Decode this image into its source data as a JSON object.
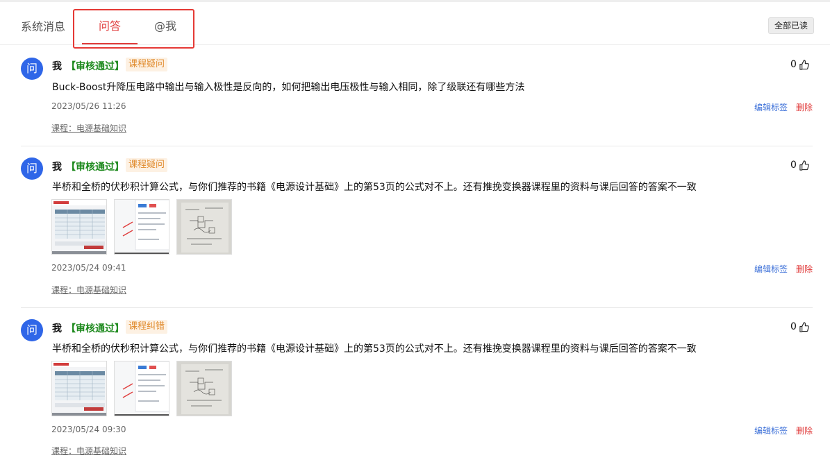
{
  "tabs": {
    "system": "系统消息",
    "qa": "问答",
    "at_me": "@我",
    "mark_all_read": "全部已读"
  },
  "colors": {
    "accent": "#e03b3b",
    "avatar": "#2f66e8",
    "approved": "#1e8a1e",
    "tag": "#e08a2c",
    "link": "#3b6fd8"
  },
  "items": [
    {
      "avatar_char": "问",
      "author": "我",
      "status": "【审核通过】",
      "tag": "课程疑问",
      "likes": "0",
      "question": "Buck-Boost升降压电路中输出与输入极性是反向的，如何把输出电压极性与输入相同，除了级联还有哪些方法",
      "date": "2023/05/26 11:26",
      "edit_tags": "编辑标签",
      "delete": "删除",
      "course": "课程：电源基础知识"
    },
    {
      "avatar_char": "问",
      "author": "我",
      "status": "【审核通过】",
      "tag": "课程疑问",
      "likes": "0",
      "question": "半桥和全桥的伏秒积计算公式，与你们推荐的书籍《电源设计基础》上的第53页的公式对不上。还有推挽变换器课程里的资料与课后回答的答案不一致",
      "date": "2023/05/24 09:41",
      "edit_tags": "编辑标签",
      "delete": "删除",
      "course": "课程：电源基础知识"
    },
    {
      "avatar_char": "问",
      "author": "我",
      "status": "【审核通过】",
      "tag": "课程纠错",
      "likes": "0",
      "question": "半桥和全桥的伏秒积计算公式，与你们推荐的书籍《电源设计基础》上的第53页的公式对不上。还有推挽变换器课程里的资料与课后回答的答案不一致",
      "date": "2023/05/24 09:30",
      "edit_tags": "编辑标签",
      "delete": "删除",
      "course": "课程：电源基础知识"
    }
  ]
}
